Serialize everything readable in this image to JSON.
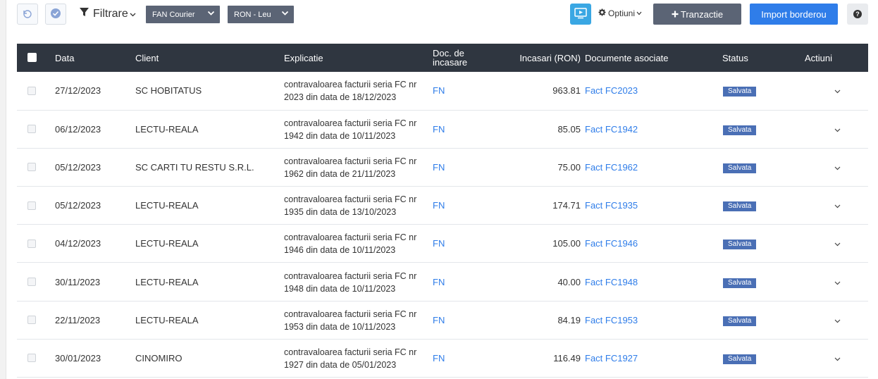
{
  "toolbar": {
    "filter_label": "Filtrare",
    "courier_select": "FAN Courier",
    "currency_select": "RON - Leu",
    "options_label": "Optiuni",
    "add_transaction_label": "Tranzactie",
    "import_label": "Import borderou",
    "help_label": "?"
  },
  "table": {
    "headers": {
      "date": "Data",
      "client": "Client",
      "explanation": "Explicatie",
      "doc_line1": "Doc. de",
      "doc_line2": "incasare",
      "amount": "Incasari (RON)",
      "documents": "Documente asociate",
      "status": "Status",
      "actions": "Actiuni"
    },
    "rows": [
      {
        "date": "27/12/2023",
        "client": "SC HOBITATUS",
        "expl1": "contravaloarea facturii seria FC nr",
        "expl2": "2023 din data de 18/12/2023",
        "doc": "FN",
        "amount": "963.81",
        "invoice": "Fact FC2023",
        "status": "Salvata"
      },
      {
        "date": "06/12/2023",
        "client": "LECTU-REALA",
        "expl1": "contravaloarea facturii seria FC nr",
        "expl2": "1942 din data de 10/11/2023",
        "doc": "FN",
        "amount": "85.05",
        "invoice": "Fact FC1942",
        "status": "Salvata"
      },
      {
        "date": "05/12/2023",
        "client": "SC CARTI TU RESTU S.R.L.",
        "expl1": "contravaloarea facturii seria FC nr",
        "expl2": "1962 din data de 21/11/2023",
        "doc": "FN",
        "amount": "75.00",
        "invoice": "Fact FC1962",
        "status": "Salvata"
      },
      {
        "date": "05/12/2023",
        "client": "LECTU-REALA",
        "expl1": "contravaloarea facturii seria FC nr",
        "expl2": "1935 din data de 13/10/2023",
        "doc": "FN",
        "amount": "174.71",
        "invoice": "Fact FC1935",
        "status": "Salvata"
      },
      {
        "date": "04/12/2023",
        "client": "LECTU-REALA",
        "expl1": "contravaloarea facturii seria FC nr",
        "expl2": "1946 din data de 10/11/2023",
        "doc": "FN",
        "amount": "105.00",
        "invoice": "Fact FC1946",
        "status": "Salvata"
      },
      {
        "date": "30/11/2023",
        "client": "LECTU-REALA",
        "expl1": "contravaloarea facturii seria FC nr",
        "expl2": "1948 din data de 10/11/2023",
        "doc": "FN",
        "amount": "40.00",
        "invoice": "Fact FC1948",
        "status": "Salvata"
      },
      {
        "date": "22/11/2023",
        "client": "LECTU-REALA",
        "expl1": "contravaloarea facturii seria FC nr",
        "expl2": "1953 din data de 10/11/2023",
        "doc": "FN",
        "amount": "84.19",
        "invoice": "Fact FC1953",
        "status": "Salvata"
      },
      {
        "date": "30/01/2023",
        "client": "CINOMIRO",
        "expl1": "contravaloarea facturii seria FC nr",
        "expl2": "1927 din data de 05/01/2023",
        "doc": "FN",
        "amount": "116.49",
        "invoice": "Fact FC1927",
        "status": "Salvata"
      }
    ]
  },
  "colors": {
    "header_bg": "#2f3640",
    "primary_blue": "#2f7de9",
    "dark_button": "#5b6475",
    "status_badge": "#4a6fb5",
    "tv_button": "#3aa7e3"
  }
}
